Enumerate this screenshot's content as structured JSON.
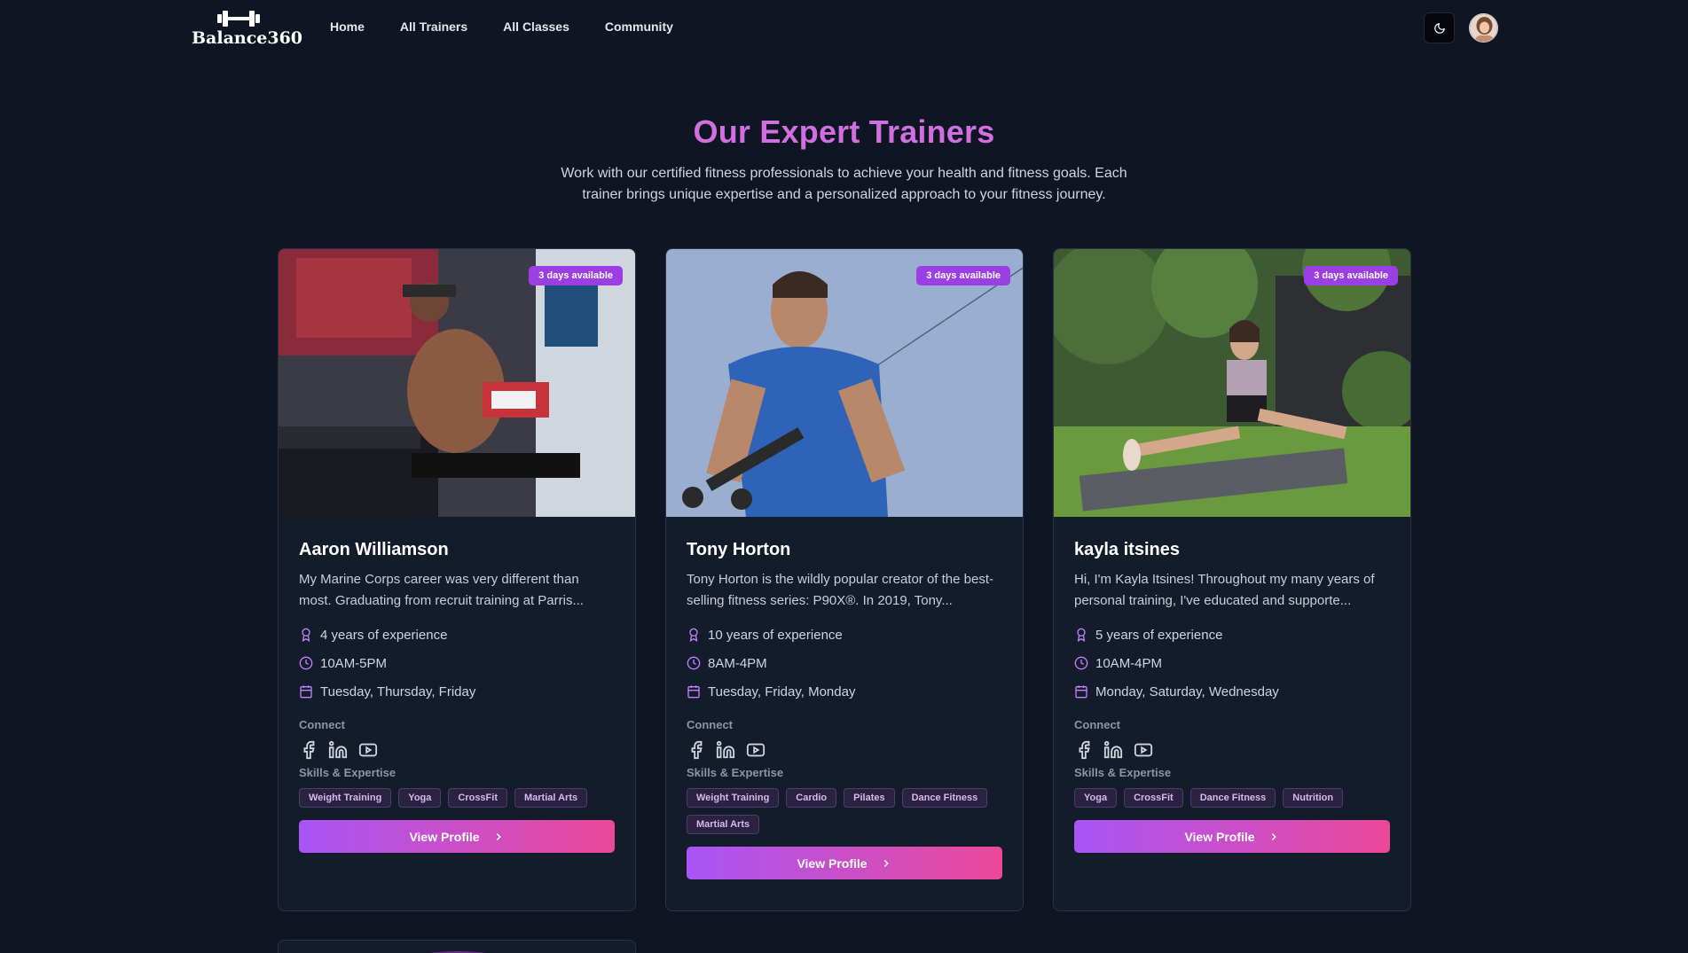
{
  "brand": {
    "name": "Balance360"
  },
  "nav": {
    "links": [
      "Home",
      "All Trainers",
      "All Classes",
      "Community"
    ]
  },
  "hero": {
    "title": "Our Expert Trainers",
    "subtitle": "Work with our certified fitness professionals to achieve your health and fitness goals. Each trainer brings unique expertise and a personalized approach to your fitness journey."
  },
  "labels": {
    "connect": "Connect",
    "skills": "Skills & Expertise",
    "view_profile": "View Profile"
  },
  "colors": {
    "accent_title": "#d16ee0",
    "badge": "#9b3ee3",
    "button_gradient_start": "#a855f7",
    "button_gradient_end": "#ec4899",
    "background": "#0f1523"
  },
  "trainers": [
    {
      "badge": "3 days available",
      "name": "Aaron Williamson",
      "bio": "My Marine Corps career was very different than most. Graduating from recruit training at Parris...",
      "experience": "4 years of experience",
      "hours": "10AM-5PM",
      "days": "Tuesday, Thursday, Friday",
      "skills": [
        "Weight Training",
        "Yoga",
        "CrossFit",
        "Martial Arts"
      ]
    },
    {
      "badge": "3 days available",
      "name": "Tony Horton",
      "bio": "Tony Horton is the wildly popular creator of the best-selling fitness series: P90X®. In 2019, Tony...",
      "experience": "10 years of experience",
      "hours": "8AM-4PM",
      "days": "Tuesday, Friday, Monday",
      "skills": [
        "Weight Training",
        "Cardio",
        "Pilates",
        "Dance Fitness",
        "Martial Arts"
      ]
    },
    {
      "badge": "3 days available",
      "name": "kayla itsines",
      "bio": "Hi, I'm Kayla Itsines! Throughout my many years of personal training, I've educated and supporte...",
      "experience": "5 years of experience",
      "hours": "10AM-4PM",
      "days": "Monday, Saturday, Wednesday",
      "skills": [
        "Yoga",
        "CrossFit",
        "Dance Fitness",
        "Nutrition"
      ]
    }
  ]
}
